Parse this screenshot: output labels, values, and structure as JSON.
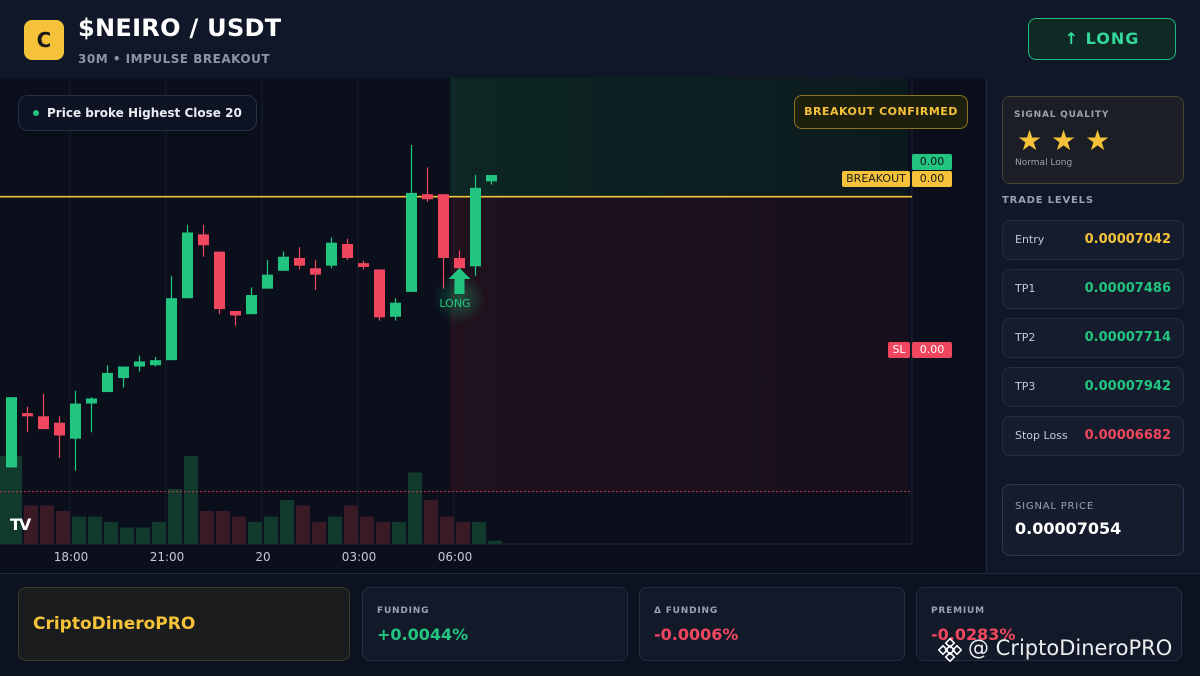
{
  "header": {
    "logo_letter": "C",
    "pair": "$NEIRO / USDT",
    "subtitle": "30M • IMPULSE BREAKOUT",
    "signal_button": "↑ LONG"
  },
  "chart": {
    "info_pill": "Price broke Highest Close 20",
    "badge": "BREAKOUT CONFIRMED",
    "breakout_tag": "BREAKOUT",
    "breakout_value": "0.00",
    "top_value": "0.00",
    "sl_tag": "SL",
    "sl_value": "0.00",
    "long_label": "LONG",
    "x_ticks": [
      "18:00",
      "21:00",
      "20",
      "03:00",
      "06:00"
    ],
    "tv_logo": "TV",
    "colors": {
      "up": "#22c57f",
      "down": "#f0475f",
      "breakout": "#f5c23a",
      "sl": "#f0475f"
    },
    "candles": [
      {
        "o": 6.72e-05,
        "h": 6.83e-05,
        "l": 6.72e-05,
        "c": 6.83e-05
      },
      {
        "o": 6.805e-05,
        "h": 6.815e-05,
        "l": 6.775e-05,
        "c": 6.8e-05
      },
      {
        "o": 6.8e-05,
        "h": 6.835e-05,
        "l": 6.78e-05,
        "c": 6.78e-05
      },
      {
        "o": 6.79e-05,
        "h": 6.8e-05,
        "l": 6.735e-05,
        "c": 6.77e-05
      },
      {
        "o": 6.765e-05,
        "h": 6.84e-05,
        "l": 6.715e-05,
        "c": 6.82e-05
      },
      {
        "o": 6.82e-05,
        "h": 6.83e-05,
        "l": 6.775e-05,
        "c": 6.828e-05
      },
      {
        "o": 6.838e-05,
        "h": 6.88e-05,
        "l": 6.838e-05,
        "c": 6.868e-05
      },
      {
        "o": 6.86e-05,
        "h": 6.875e-05,
        "l": 6.845e-05,
        "c": 6.878e-05
      },
      {
        "o": 6.878e-05,
        "h": 6.895e-05,
        "l": 6.87e-05,
        "c": 6.886e-05
      },
      {
        "o": 6.88e-05,
        "h": 6.893e-05,
        "l": 6.878e-05,
        "c": 6.888e-05
      },
      {
        "o": 6.888e-05,
        "h": 7.02e-05,
        "l": 6.888e-05,
        "c": 6.985e-05
      },
      {
        "o": 6.985e-05,
        "h": 7.1e-05,
        "l": 6.985e-05,
        "c": 7.088e-05
      },
      {
        "o": 7.085e-05,
        "h": 7.1e-05,
        "l": 7.05e-05,
        "c": 7.068e-05
      },
      {
        "o": 7.058e-05,
        "h": 7.058e-05,
        "l": 6.96e-05,
        "c": 6.968e-05
      },
      {
        "o": 6.965e-05,
        "h": 6.965e-05,
        "l": 6.942e-05,
        "c": 6.958e-05
      },
      {
        "o": 6.96e-05,
        "h": 7.002e-05,
        "l": 6.96e-05,
        "c": 6.99e-05
      },
      {
        "o": 7e-05,
        "h": 7.045e-05,
        "l": 7e-05,
        "c": 7.022e-05
      },
      {
        "o": 7.028e-05,
        "h": 7.058e-05,
        "l": 7.028e-05,
        "c": 7.05e-05
      },
      {
        "o": 7.048e-05,
        "h": 7.065e-05,
        "l": 7.03e-05,
        "c": 7.036e-05
      },
      {
        "o": 7.032e-05,
        "h": 7.045e-05,
        "l": 6.998e-05,
        "c": 7.022e-05
      },
      {
        "o": 7.036e-05,
        "h": 7.08e-05,
        "l": 7.032e-05,
        "c": 7.072e-05
      },
      {
        "o": 7.07e-05,
        "h": 7.078e-05,
        "l": 7.045e-05,
        "c": 7.048e-05
      },
      {
        "o": 7.04e-05,
        "h": 7.044e-05,
        "l": 7.03e-05,
        "c": 7.034e-05
      },
      {
        "o": 7.03e-05,
        "h": 7.03e-05,
        "l": 6.95e-05,
        "c": 6.955e-05
      },
      {
        "o": 6.956e-05,
        "h": 6.985e-05,
        "l": 6.95e-05,
        "c": 6.978e-05
      },
      {
        "o": 6.995e-05,
        "h": 7.225e-05,
        "l": 6.995e-05,
        "c": 7.15e-05
      },
      {
        "o": 7.148e-05,
        "h": 7.19e-05,
        "l": 7.136e-05,
        "c": 7.14e-05
      },
      {
        "o": 7.148e-05,
        "h": 7.148e-05,
        "l": 7e-05,
        "c": 7.048e-05
      },
      {
        "o": 7.048e-05,
        "h": 7.06e-05,
        "l": 7.01e-05,
        "c": 7.032e-05
      },
      {
        "o": 7.035e-05,
        "h": 7.178e-05,
        "l": 7.02e-05,
        "c": 7.158e-05
      },
      {
        "o": 7.168e-05,
        "h": 7.178e-05,
        "l": 7.163e-05,
        "c": 7.178e-05
      }
    ],
    "volumes": [
      0.16,
      0.07,
      0.07,
      0.06,
      0.05,
      0.05,
      0.04,
      0.03,
      0.03,
      0.04,
      0.1,
      0.16,
      0.06,
      0.06,
      0.05,
      0.04,
      0.05,
      0.08,
      0.07,
      0.04,
      0.05,
      0.07,
      0.05,
      0.04,
      0.04,
      0.13,
      0.08,
      0.05,
      0.04,
      0.04,
      0.006
    ],
    "volume_at_left_edge": 0.16,
    "breakout_level": 7.144e-05,
    "sl_level": 6.682e-05,
    "y_range": [
      6.6e-05,
      7.33e-05
    ]
  },
  "sidebar": {
    "quality_title": "SIGNAL QUALITY",
    "stars": [
      "★",
      "★",
      "★"
    ],
    "quality_text": "Normal Long",
    "trade_levels_title": "TRADE LEVELS",
    "levels": [
      {
        "name": "Entry",
        "value": "0.00007042",
        "color": "#f5c23a"
      },
      {
        "name": "TP1",
        "value": "0.00007486",
        "color": "#22c57f"
      },
      {
        "name": "TP2",
        "value": "0.00007714",
        "color": "#22c57f"
      },
      {
        "name": "TP3",
        "value": "0.00007942",
        "color": "#22c57f"
      },
      {
        "name": "Stop Loss",
        "value": "0.00006682",
        "color": "#f0475f"
      }
    ],
    "signal_price_title": "SIGNAL PRICE",
    "signal_price": "0.00007054"
  },
  "footer": {
    "brand": "CriptoDineroPRO",
    "stats": [
      {
        "title": "FUNDING",
        "value": "+0.0044%",
        "color": "#22c57f"
      },
      {
        "title": "Δ FUNDING",
        "value": "-0.0006%",
        "color": "#f0475f"
      },
      {
        "title": "PREMIUM",
        "value": "-0.0283%",
        "color": "#f0475f"
      }
    ],
    "watermark": "@ CriptoDineroPRO"
  }
}
